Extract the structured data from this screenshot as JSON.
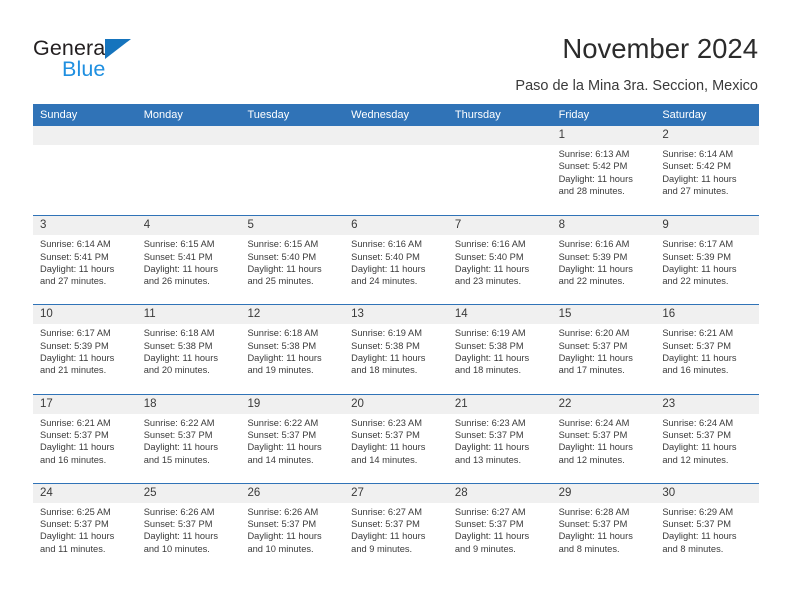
{
  "brand": {
    "name_part1": "General",
    "name_part2": "Blue",
    "triangle_color": "#1574bd",
    "blue_color": "#1f8fe0",
    "dark_color": "#231f20"
  },
  "header": {
    "title": "November 2024",
    "subtitle": "Paso de la Mina 3ra. Seccion, Mexico",
    "accent_color": "#3073b7",
    "band_color": "#f0f0f0"
  },
  "calendar": {
    "weekdays": [
      "Sunday",
      "Monday",
      "Tuesday",
      "Wednesday",
      "Thursday",
      "Friday",
      "Saturday"
    ],
    "weeks": [
      [
        {
          "day": "",
          "sunrise": "",
          "sunset": "",
          "daylight1": "",
          "daylight2": "",
          "empty": true
        },
        {
          "day": "",
          "sunrise": "",
          "sunset": "",
          "daylight1": "",
          "daylight2": "",
          "empty": true
        },
        {
          "day": "",
          "sunrise": "",
          "sunset": "",
          "daylight1": "",
          "daylight2": "",
          "empty": true
        },
        {
          "day": "",
          "sunrise": "",
          "sunset": "",
          "daylight1": "",
          "daylight2": "",
          "empty": true
        },
        {
          "day": "",
          "sunrise": "",
          "sunset": "",
          "daylight1": "",
          "daylight2": "",
          "empty": true
        },
        {
          "day": "1",
          "sunrise": "Sunrise: 6:13 AM",
          "sunset": "Sunset: 5:42 PM",
          "daylight1": "Daylight: 11 hours",
          "daylight2": "and 28 minutes.",
          "empty": false
        },
        {
          "day": "2",
          "sunrise": "Sunrise: 6:14 AM",
          "sunset": "Sunset: 5:42 PM",
          "daylight1": "Daylight: 11 hours",
          "daylight2": "and 27 minutes.",
          "empty": false
        }
      ],
      [
        {
          "day": "3",
          "sunrise": "Sunrise: 6:14 AM",
          "sunset": "Sunset: 5:41 PM",
          "daylight1": "Daylight: 11 hours",
          "daylight2": "and 27 minutes.",
          "empty": false
        },
        {
          "day": "4",
          "sunrise": "Sunrise: 6:15 AM",
          "sunset": "Sunset: 5:41 PM",
          "daylight1": "Daylight: 11 hours",
          "daylight2": "and 26 minutes.",
          "empty": false
        },
        {
          "day": "5",
          "sunrise": "Sunrise: 6:15 AM",
          "sunset": "Sunset: 5:40 PM",
          "daylight1": "Daylight: 11 hours",
          "daylight2": "and 25 minutes.",
          "empty": false
        },
        {
          "day": "6",
          "sunrise": "Sunrise: 6:16 AM",
          "sunset": "Sunset: 5:40 PM",
          "daylight1": "Daylight: 11 hours",
          "daylight2": "and 24 minutes.",
          "empty": false
        },
        {
          "day": "7",
          "sunrise": "Sunrise: 6:16 AM",
          "sunset": "Sunset: 5:40 PM",
          "daylight1": "Daylight: 11 hours",
          "daylight2": "and 23 minutes.",
          "empty": false
        },
        {
          "day": "8",
          "sunrise": "Sunrise: 6:16 AM",
          "sunset": "Sunset: 5:39 PM",
          "daylight1": "Daylight: 11 hours",
          "daylight2": "and 22 minutes.",
          "empty": false
        },
        {
          "day": "9",
          "sunrise": "Sunrise: 6:17 AM",
          "sunset": "Sunset: 5:39 PM",
          "daylight1": "Daylight: 11 hours",
          "daylight2": "and 22 minutes.",
          "empty": false
        }
      ],
      [
        {
          "day": "10",
          "sunrise": "Sunrise: 6:17 AM",
          "sunset": "Sunset: 5:39 PM",
          "daylight1": "Daylight: 11 hours",
          "daylight2": "and 21 minutes.",
          "empty": false
        },
        {
          "day": "11",
          "sunrise": "Sunrise: 6:18 AM",
          "sunset": "Sunset: 5:38 PM",
          "daylight1": "Daylight: 11 hours",
          "daylight2": "and 20 minutes.",
          "empty": false
        },
        {
          "day": "12",
          "sunrise": "Sunrise: 6:18 AM",
          "sunset": "Sunset: 5:38 PM",
          "daylight1": "Daylight: 11 hours",
          "daylight2": "and 19 minutes.",
          "empty": false
        },
        {
          "day": "13",
          "sunrise": "Sunrise: 6:19 AM",
          "sunset": "Sunset: 5:38 PM",
          "daylight1": "Daylight: 11 hours",
          "daylight2": "and 18 minutes.",
          "empty": false
        },
        {
          "day": "14",
          "sunrise": "Sunrise: 6:19 AM",
          "sunset": "Sunset: 5:38 PM",
          "daylight1": "Daylight: 11 hours",
          "daylight2": "and 18 minutes.",
          "empty": false
        },
        {
          "day": "15",
          "sunrise": "Sunrise: 6:20 AM",
          "sunset": "Sunset: 5:37 PM",
          "daylight1": "Daylight: 11 hours",
          "daylight2": "and 17 minutes.",
          "empty": false
        },
        {
          "day": "16",
          "sunrise": "Sunrise: 6:21 AM",
          "sunset": "Sunset: 5:37 PM",
          "daylight1": "Daylight: 11 hours",
          "daylight2": "and 16 minutes.",
          "empty": false
        }
      ],
      [
        {
          "day": "17",
          "sunrise": "Sunrise: 6:21 AM",
          "sunset": "Sunset: 5:37 PM",
          "daylight1": "Daylight: 11 hours",
          "daylight2": "and 16 minutes.",
          "empty": false
        },
        {
          "day": "18",
          "sunrise": "Sunrise: 6:22 AM",
          "sunset": "Sunset: 5:37 PM",
          "daylight1": "Daylight: 11 hours",
          "daylight2": "and 15 minutes.",
          "empty": false
        },
        {
          "day": "19",
          "sunrise": "Sunrise: 6:22 AM",
          "sunset": "Sunset: 5:37 PM",
          "daylight1": "Daylight: 11 hours",
          "daylight2": "and 14 minutes.",
          "empty": false
        },
        {
          "day": "20",
          "sunrise": "Sunrise: 6:23 AM",
          "sunset": "Sunset: 5:37 PM",
          "daylight1": "Daylight: 11 hours",
          "daylight2": "and 14 minutes.",
          "empty": false
        },
        {
          "day": "21",
          "sunrise": "Sunrise: 6:23 AM",
          "sunset": "Sunset: 5:37 PM",
          "daylight1": "Daylight: 11 hours",
          "daylight2": "and 13 minutes.",
          "empty": false
        },
        {
          "day": "22",
          "sunrise": "Sunrise: 6:24 AM",
          "sunset": "Sunset: 5:37 PM",
          "daylight1": "Daylight: 11 hours",
          "daylight2": "and 12 minutes.",
          "empty": false
        },
        {
          "day": "23",
          "sunrise": "Sunrise: 6:24 AM",
          "sunset": "Sunset: 5:37 PM",
          "daylight1": "Daylight: 11 hours",
          "daylight2": "and 12 minutes.",
          "empty": false
        }
      ],
      [
        {
          "day": "24",
          "sunrise": "Sunrise: 6:25 AM",
          "sunset": "Sunset: 5:37 PM",
          "daylight1": "Daylight: 11 hours",
          "daylight2": "and 11 minutes.",
          "empty": false
        },
        {
          "day": "25",
          "sunrise": "Sunrise: 6:26 AM",
          "sunset": "Sunset: 5:37 PM",
          "daylight1": "Daylight: 11 hours",
          "daylight2": "and 10 minutes.",
          "empty": false
        },
        {
          "day": "26",
          "sunrise": "Sunrise: 6:26 AM",
          "sunset": "Sunset: 5:37 PM",
          "daylight1": "Daylight: 11 hours",
          "daylight2": "and 10 minutes.",
          "empty": false
        },
        {
          "day": "27",
          "sunrise": "Sunrise: 6:27 AM",
          "sunset": "Sunset: 5:37 PM",
          "daylight1": "Daylight: 11 hours",
          "daylight2": "and 9 minutes.",
          "empty": false
        },
        {
          "day": "28",
          "sunrise": "Sunrise: 6:27 AM",
          "sunset": "Sunset: 5:37 PM",
          "daylight1": "Daylight: 11 hours",
          "daylight2": "and 9 minutes.",
          "empty": false
        },
        {
          "day": "29",
          "sunrise": "Sunrise: 6:28 AM",
          "sunset": "Sunset: 5:37 PM",
          "daylight1": "Daylight: 11 hours",
          "daylight2": "and 8 minutes.",
          "empty": false
        },
        {
          "day": "30",
          "sunrise": "Sunrise: 6:29 AM",
          "sunset": "Sunset: 5:37 PM",
          "daylight1": "Daylight: 11 hours",
          "daylight2": "and 8 minutes.",
          "empty": false
        }
      ]
    ]
  }
}
